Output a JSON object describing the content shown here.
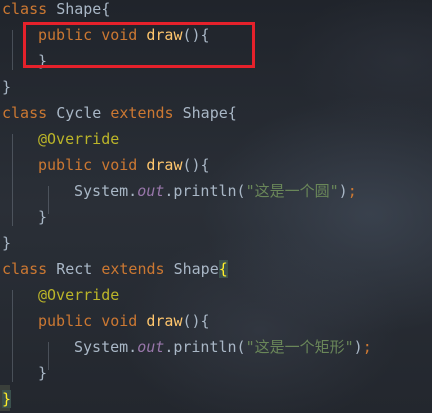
{
  "code_lines": [
    {
      "indent": 0,
      "tokens": [
        {
          "t": "class ",
          "c": "kw"
        },
        {
          "t": "Shape",
          "c": "plain"
        },
        {
          "t": "{",
          "c": "plain"
        }
      ]
    },
    {
      "indent": 1,
      "tokens": [
        {
          "t": "public ",
          "c": "kw"
        },
        {
          "t": "void ",
          "c": "kw"
        },
        {
          "t": "draw",
          "c": "fn"
        },
        {
          "t": "(){",
          "c": "plain"
        }
      ]
    },
    {
      "indent": 1,
      "tokens": [
        {
          "t": "}",
          "c": "plain"
        }
      ]
    },
    {
      "indent": 0,
      "tokens": [
        {
          "t": "}",
          "c": "plain"
        }
      ]
    },
    {
      "indent": 0,
      "tokens": [
        {
          "t": "class ",
          "c": "kw"
        },
        {
          "t": "Cycle ",
          "c": "plain"
        },
        {
          "t": "extends ",
          "c": "kw"
        },
        {
          "t": "Shape",
          "c": "plain"
        },
        {
          "t": "{",
          "c": "plain"
        }
      ]
    },
    {
      "indent": 1,
      "tokens": [
        {
          "t": "@Override",
          "c": "ann"
        }
      ]
    },
    {
      "indent": 1,
      "tokens": [
        {
          "t": "public ",
          "c": "kw"
        },
        {
          "t": "void ",
          "c": "kw"
        },
        {
          "t": "draw",
          "c": "fn"
        },
        {
          "t": "(){",
          "c": "plain"
        }
      ]
    },
    {
      "indent": 2,
      "tokens": [
        {
          "t": "System.",
          "c": "plain"
        },
        {
          "t": "out",
          "c": "fld"
        },
        {
          "t": ".println(",
          "c": "plain"
        },
        {
          "t": "\"这是一个圆\"",
          "c": "str"
        },
        {
          "t": ")",
          "c": "plain"
        },
        {
          "t": ";",
          "c": "kw"
        }
      ]
    },
    {
      "indent": 1,
      "tokens": [
        {
          "t": "}",
          "c": "plain"
        }
      ]
    },
    {
      "indent": 0,
      "tokens": [
        {
          "t": "}",
          "c": "plain"
        }
      ]
    },
    {
      "indent": 0,
      "tokens": [
        {
          "t": "class ",
          "c": "kw"
        },
        {
          "t": "Rect ",
          "c": "plain"
        },
        {
          "t": "extends ",
          "c": "kw"
        },
        {
          "t": "Shape",
          "c": "plain"
        },
        {
          "t": "{",
          "c": "brace-hl"
        }
      ]
    },
    {
      "indent": 1,
      "tokens": [
        {
          "t": "@Override",
          "c": "ann"
        }
      ]
    },
    {
      "indent": 1,
      "tokens": [
        {
          "t": "public ",
          "c": "kw"
        },
        {
          "t": "void ",
          "c": "kw"
        },
        {
          "t": "draw",
          "c": "fn"
        },
        {
          "t": "(){",
          "c": "plain"
        }
      ]
    },
    {
      "indent": 2,
      "tokens": [
        {
          "t": "System.",
          "c": "plain"
        },
        {
          "t": "out",
          "c": "fld"
        },
        {
          "t": ".println(",
          "c": "plain"
        },
        {
          "t": "\"这是一个矩形\"",
          "c": "str"
        },
        {
          "t": ")",
          "c": "plain"
        },
        {
          "t": ";",
          "c": "kw"
        }
      ]
    },
    {
      "indent": 1,
      "tokens": [
        {
          "t": "}",
          "c": "plain"
        }
      ]
    },
    {
      "indent": 0,
      "tokens": [
        {
          "t": "}",
          "c": "brace-hl"
        }
      ]
    }
  ],
  "highlight": {
    "color": "#e5212b",
    "target": "Shape.draw method body"
  },
  "colors": {
    "keyword": "#cc7832",
    "function": "#ffc66d",
    "annotation": "#bbb529",
    "string": "#6a8759",
    "field": "#9876aa",
    "text": "#a9b7c6"
  }
}
